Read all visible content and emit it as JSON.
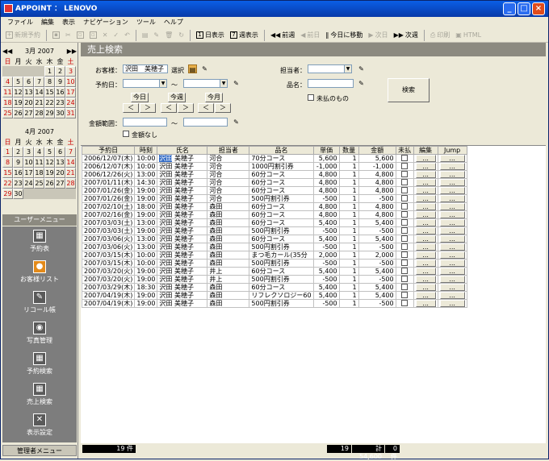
{
  "window": {
    "title": "APPOINT ： LENOVO",
    "min": "_",
    "max": "□",
    "close": "×"
  },
  "menu": [
    "ファイル",
    "編集",
    "表示",
    "ナビゲーション",
    "ツール",
    "ヘルプ"
  ],
  "toolbar": {
    "new_reserve": "新規予約",
    "day_view": "日表示",
    "week_view": "週表示",
    "prev": "前週",
    "prev_day": "前日",
    "today_move": "今日に移動",
    "next_day": "次日",
    "next": "次週",
    "print": "印刷",
    "html": "HTML"
  },
  "cal1": {
    "title": "3月 2007",
    "dow": [
      "日",
      "月",
      "火",
      "水",
      "木",
      "金",
      "土"
    ],
    "days": [
      "",
      "",
      "",
      "",
      "1",
      "2",
      "3",
      "4",
      "5",
      "6",
      "7",
      "8",
      "9",
      "10",
      "11",
      "12",
      "13",
      "14",
      "15",
      "16",
      "17",
      "18",
      "19",
      "20",
      "21",
      "22",
      "23",
      "24",
      "25",
      "26",
      "27",
      "28",
      "29",
      "30",
      "31"
    ]
  },
  "cal2": {
    "title": "4月 2007",
    "dow": [
      "日",
      "月",
      "火",
      "水",
      "木",
      "金",
      "土"
    ],
    "days": [
      "1",
      "2",
      "3",
      "4",
      "5",
      "6",
      "7",
      "8",
      "9",
      "10",
      "11",
      "12",
      "13",
      "14",
      "15",
      "16",
      "17",
      "18",
      "19",
      "20",
      "21",
      "22",
      "23",
      "24",
      "25",
      "26",
      "27",
      "28",
      "29",
      "30"
    ]
  },
  "sidebar": {
    "user_menu": "ユーザーメニュー",
    "items": [
      {
        "label": "予約表",
        "icon": "calendar-icon"
      },
      {
        "label": "お客様リスト",
        "icon": "customers-icon"
      },
      {
        "label": "リコール帳",
        "icon": "recall-icon"
      },
      {
        "label": "写真管理",
        "icon": "camera-icon"
      },
      {
        "label": "予約検索",
        "icon": "reserve-search-icon"
      },
      {
        "label": "売上検索",
        "icon": "sales-search-icon"
      },
      {
        "label": "表示設定",
        "icon": "tools-icon"
      }
    ],
    "admin_menu": "管理者メニュー"
  },
  "form": {
    "heading": "売上検索",
    "customer_label": "お客様：",
    "customer_value": "沢田　美穂子",
    "select_btn": "選択",
    "reserve_date_label": "予約日：",
    "tilde": "～",
    "today_btn": "今日",
    "week_btn": "今週",
    "month_btn": "今月",
    "prev_arrow": "＜",
    "next_arrow": "＞",
    "amount_label": "金額範囲：",
    "no_amount": "金額なし",
    "staff_label": "担当者：",
    "item_label": "品名：",
    "unpaid_label": "未払のもの",
    "search_btn": "検索"
  },
  "table": {
    "headers": [
      "予約日",
      "時刻",
      "氏名",
      "担当者",
      "品名",
      "単価",
      "数量",
      "金額",
      "未払",
      "編集",
      "Jump"
    ],
    "btn_label": "...",
    "rows": [
      [
        "2006/12/07(木)",
        "10:00",
        "沢田",
        "美穂子",
        "河合",
        "70分コース",
        "5,600",
        "1",
        "5,600"
      ],
      [
        "2006/12/07(木)",
        "10:00",
        "沢田",
        "美穂子",
        "河合",
        "1000円割引券",
        "-1,000",
        "1",
        "-1,000"
      ],
      [
        "2006/12/26(火)",
        "13:00",
        "沢田",
        "美穂子",
        "河合",
        "60分コース",
        "4,800",
        "1",
        "4,800"
      ],
      [
        "2007/01/11(木)",
        "14:30",
        "沢田",
        "美穂子",
        "河合",
        "60分コース",
        "4,800",
        "1",
        "4,800"
      ],
      [
        "2007/01/26(金)",
        "19:00",
        "沢田",
        "美穂子",
        "河合",
        "60分コース",
        "4,800",
        "1",
        "4,800"
      ],
      [
        "2007/01/26(金)",
        "19:00",
        "沢田",
        "美穂子",
        "河合",
        "500円割引券",
        "-500",
        "1",
        "-500"
      ],
      [
        "2007/02/10(土)",
        "18:00",
        "沢田",
        "美穂子",
        "森田",
        "60分コース",
        "4,800",
        "1",
        "4,800"
      ],
      [
        "2007/02/16(金)",
        "19:00",
        "沢田",
        "美穂子",
        "森田",
        "60分コース",
        "4,800",
        "1",
        "4,800"
      ],
      [
        "2007/03/03(土)",
        "13:00",
        "沢田",
        "美穂子",
        "森田",
        "60分コース",
        "5,400",
        "1",
        "5,400"
      ],
      [
        "2007/03/03(土)",
        "19:00",
        "沢田",
        "美穂子",
        "森田",
        "500円割引券",
        "-500",
        "1",
        "-500"
      ],
      [
        "2007/03/06(火)",
        "13:00",
        "沢田",
        "美穂子",
        "森田",
        "60分コース",
        "5,400",
        "1",
        "5,400"
      ],
      [
        "2007/03/06(火)",
        "13:00",
        "沢田",
        "美穂子",
        "森田",
        "500円割引券",
        "-500",
        "1",
        "-500"
      ],
      [
        "2007/03/15(木)",
        "10:00",
        "沢田",
        "美穂子",
        "森田",
        "まつ毛カール(35分",
        "2,000",
        "1",
        "2,000"
      ],
      [
        "2007/03/15(木)",
        "10:00",
        "沢田",
        "美穂子",
        "森田",
        "500円割引券",
        "-500",
        "1",
        "-500"
      ],
      [
        "2007/03/20(火)",
        "19:00",
        "沢田",
        "美穂子",
        "井上",
        "60分コース",
        "5,400",
        "1",
        "5,400"
      ],
      [
        "2007/03/20(火)",
        "19:00",
        "沢田",
        "美穂子",
        "井上",
        "500円割引券",
        "-500",
        "1",
        "-500"
      ],
      [
        "2007/03/29(木)",
        "18:30",
        "沢田",
        "美穂子",
        "森田",
        "60分コース",
        "5,400",
        "1",
        "5,400"
      ],
      [
        "2007/04/19(木)",
        "19:00",
        "沢田",
        "美穂子",
        "森田",
        "リフレクソロジー60",
        "5,400",
        "1",
        "5,400"
      ],
      [
        "2007/04/19(木)",
        "19:00",
        "沢田",
        "美穂子",
        "森田",
        "500円割引券",
        "-500",
        "1",
        "-500"
      ]
    ]
  },
  "status": {
    "count": "19 件",
    "count2": "19",
    "total": "計 54,600",
    "unpaid": "0 件"
  }
}
